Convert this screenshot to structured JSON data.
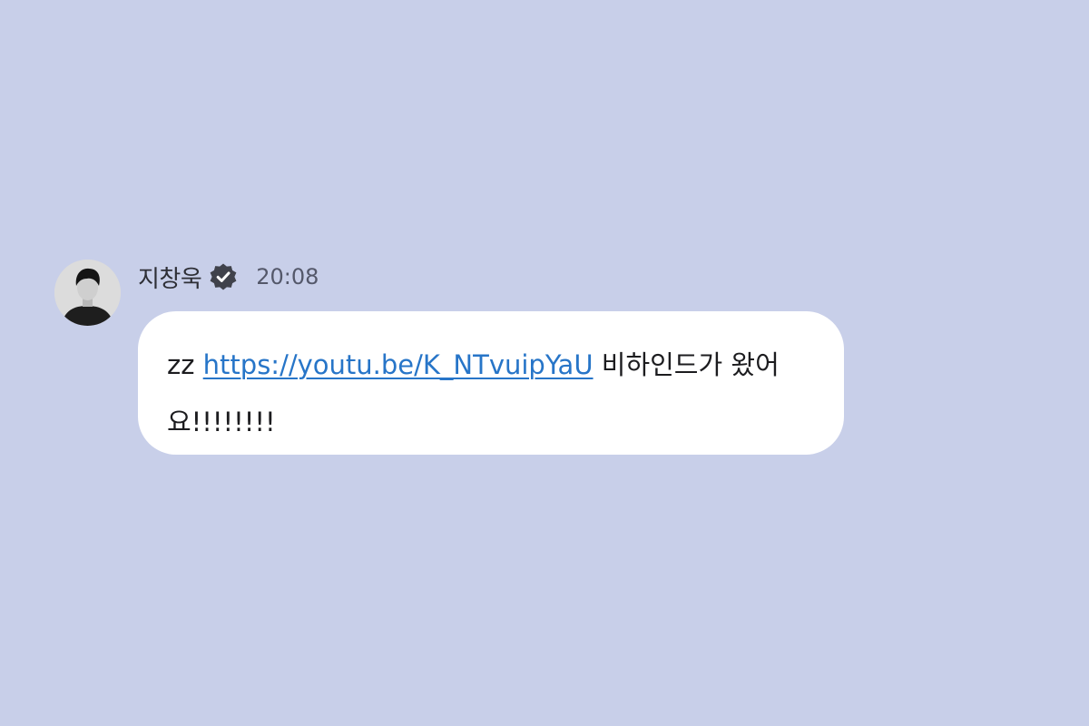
{
  "message": {
    "sender_name": "지창욱",
    "verified_icon": "verified-badge-icon",
    "timestamp": "20:08",
    "text_prefix": "zz ",
    "link_text": "https://youtu.be/K_NTvuipYaU",
    "text_suffix": " 비하인드가 왔어요!!!!!!!!"
  },
  "colors": {
    "background": "#c8cfe9",
    "bubble": "#ffffff",
    "link": "#2775c8",
    "badge": "#40424b"
  }
}
